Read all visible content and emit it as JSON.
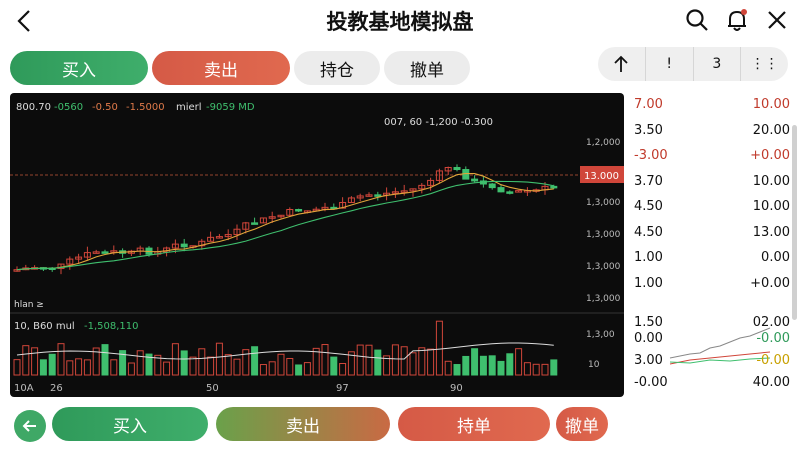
{
  "header": {
    "title": "投教基地模拟盘"
  },
  "top_buttons": {
    "buy": "买入",
    "sell": "卖出",
    "hold": "持仓",
    "cancel": "撤单"
  },
  "tools": {
    "t2": "!",
    "t3": "3",
    "t4": "⋮⋮"
  },
  "chart": {
    "legend": [
      "800.70",
      "-0560",
      "-0.50",
      "-1.5000",
      "mierl",
      "-9059 MD"
    ],
    "annotation": "007, 60 -1,200 -0.300",
    "price_marker": "13.000",
    "price_ticks": [
      "1,2,000",
      "1,3,000",
      "1,3,000",
      "1,3,000",
      "1,3,000"
    ],
    "left_label": "hlan ≥",
    "volume_legend": [
      "10, B60 mul",
      "-1,508,110"
    ],
    "volume_ticks": [
      "1,3,00",
      "10"
    ],
    "x_labels": [
      "10A",
      "26",
      "50",
      "97",
      "90"
    ]
  },
  "side_values": [
    {
      "l": "7.00",
      "r": "10.00",
      "lc": "#c03a2b",
      "rc": "#c03a2b"
    },
    {
      "l": "3.50",
      "r": "20.00",
      "lc": "#111",
      "rc": "#111"
    },
    {
      "l": "-3.00",
      "r": "+0.00",
      "lc": "#c03a2b",
      "rc": "#c03a2b"
    },
    {
      "l": "3.70",
      "r": "10.00",
      "lc": "#111",
      "rc": "#111"
    },
    {
      "l": "4.50",
      "r": "10.00",
      "lc": "#111",
      "rc": "#111"
    },
    {
      "l": "4.50",
      "r": "13.00",
      "lc": "#111",
      "rc": "#111"
    },
    {
      "l": "1.00",
      "r": "0.00",
      "lc": "#111",
      "rc": "#111"
    },
    {
      "l": "1.00",
      "r": "+0.00",
      "lc": "#111",
      "rc": "#111"
    }
  ],
  "side_mini": {
    "values": [
      {
        "l": "1.50",
        "r": "02.00",
        "lc": "#111",
        "rc": "#111"
      },
      {
        "l": "0.00",
        "r": "-0.00",
        "lc": "#111",
        "rc": "#2f9a5a"
      },
      {
        "l": "3.00",
        "r": "-0.00",
        "lc": "#111",
        "rc": "#c8a000"
      },
      {
        "l": "-0.00",
        "r": "40.00",
        "lc": "#111",
        "rc": "#111"
      }
    ]
  },
  "bottom_buttons": {
    "buy": "买入",
    "sell": "卖出",
    "hold": "持单",
    "cancel": "撤单"
  },
  "colors": {
    "up": "#d0463a",
    "down": "#3fbf6e",
    "accent": "#3fa866"
  }
}
